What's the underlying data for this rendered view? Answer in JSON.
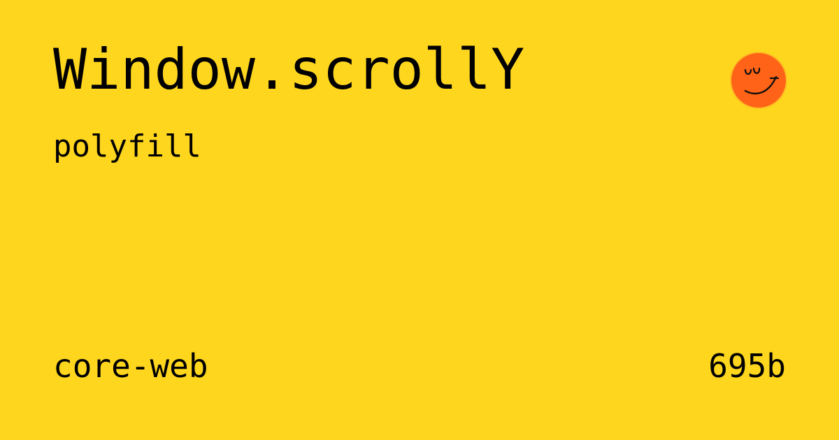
{
  "card": {
    "title": "Window.scrollY",
    "subtitle": "polyfill",
    "category": "core-web",
    "size": "695b",
    "logo_icon": "smiley-face-icon",
    "colors": {
      "background": "#FFD61E",
      "text": "#000000",
      "logo_fill": "#FF6317"
    }
  }
}
